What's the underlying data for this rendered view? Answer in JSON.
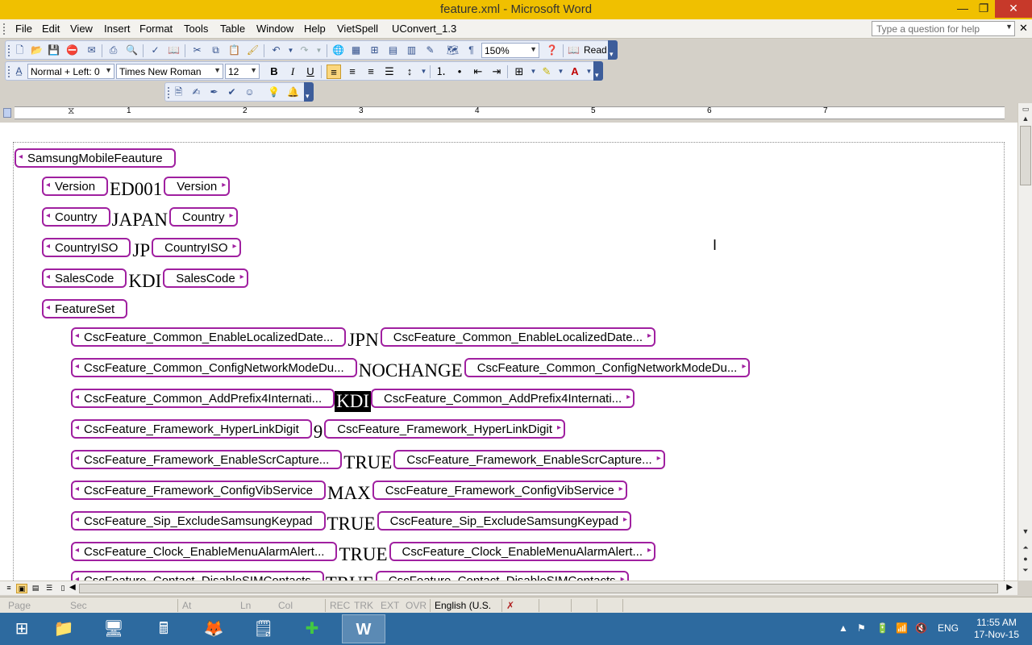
{
  "window": {
    "title": "feature.xml - Microsoft Word",
    "minimize": "—",
    "maximize": "❐",
    "close": "✕"
  },
  "menu": {
    "items": [
      "File",
      "Edit",
      "View",
      "Insert",
      "Format",
      "Tools",
      "Table",
      "Window",
      "Help",
      "VietSpell",
      "UConvert_1.3"
    ],
    "help_placeholder": "Type a question for help",
    "doc_close": "✕"
  },
  "toolbar_standard": {
    "zoom": "150%",
    "read_label": "Read"
  },
  "toolbar_formatting": {
    "style": "Normal + Left:  0",
    "font": "Times New Roman",
    "size": "12",
    "bold": "B",
    "italic": "I",
    "underline": "U"
  },
  "ruler": {
    "numbers": [
      "1",
      "2",
      "3",
      "4",
      "5",
      "6",
      "7"
    ]
  },
  "document": {
    "root": "SamsungMobileFeauture",
    "header_rows": [
      {
        "tag": "Version",
        "value": "ED001"
      },
      {
        "tag": "Country",
        "value": "JAPAN"
      },
      {
        "tag": "CountryISO",
        "value": "JP"
      },
      {
        "tag": "SalesCode",
        "value": "KDI"
      }
    ],
    "featureset": "FeatureSet",
    "features": [
      {
        "tag": "CscFeature_Common_EnableLocalizedDate...",
        "value": "JPN"
      },
      {
        "tag": "CscFeature_Common_ConfigNetworkModeDu...",
        "value": "NOCHANGE"
      },
      {
        "tag": "CscFeature_Common_AddPrefix4Internati...",
        "value": "KDI",
        "selected": true
      },
      {
        "tag": "CscFeature_Framework_HyperLinkDigit",
        "value": "9"
      },
      {
        "tag": "CscFeature_Framework_EnableScrCapture...",
        "value": "TRUE"
      },
      {
        "tag": "CscFeature_Framework_ConfigVibService",
        "value": "MAX"
      },
      {
        "tag": "CscFeature_Sip_ExcludeSamsungKeypad",
        "value": "TRUE"
      },
      {
        "tag": "CscFeature_Clock_EnableMenuAlarmAlert...",
        "value": "TRUE"
      },
      {
        "tag": "CscFeature_Contact_DisableSIMContacts",
        "value": "TRUE"
      }
    ]
  },
  "statusbar": {
    "page": "Page",
    "sec": "Sec",
    "at": "At",
    "ln": "Ln",
    "col": "Col",
    "rec": "REC",
    "trk": "TRK",
    "ext": "EXT",
    "ovr": "OVR",
    "language": "English (U.S."
  },
  "taskbar": {
    "language": "ENG",
    "time": "11:55 AM",
    "date": "17-Nov-15"
  }
}
